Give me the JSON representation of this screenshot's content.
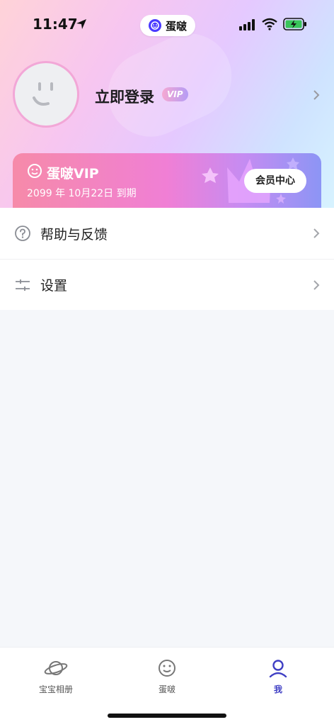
{
  "status_bar": {
    "time": "11:47",
    "app_name": "蛋啵"
  },
  "profile": {
    "login_text": "立即登录",
    "vip_tag": "VIP"
  },
  "vip_card": {
    "brand_name": "蛋啵VIP",
    "expire_text": "2099 年 10月22日 到期",
    "member_center_label": "会员中心"
  },
  "menu": {
    "items": [
      {
        "label": "帮助与反馈",
        "icon": "help-circle-icon"
      },
      {
        "label": "设置",
        "icon": "sliders-icon"
      }
    ]
  },
  "tabbar": {
    "tabs": [
      {
        "label": "宝宝相册",
        "icon": "planet-icon",
        "active": false
      },
      {
        "label": "蛋啵",
        "icon": "smile-face-icon",
        "active": false
      },
      {
        "label": "我",
        "icon": "user-icon",
        "active": true
      }
    ]
  },
  "colors": {
    "accent": "#3f3fc4",
    "vip_gradient_start": "#f68aa9",
    "vip_gradient_end": "#8c95f5",
    "page_background": "#f5f7fa"
  }
}
